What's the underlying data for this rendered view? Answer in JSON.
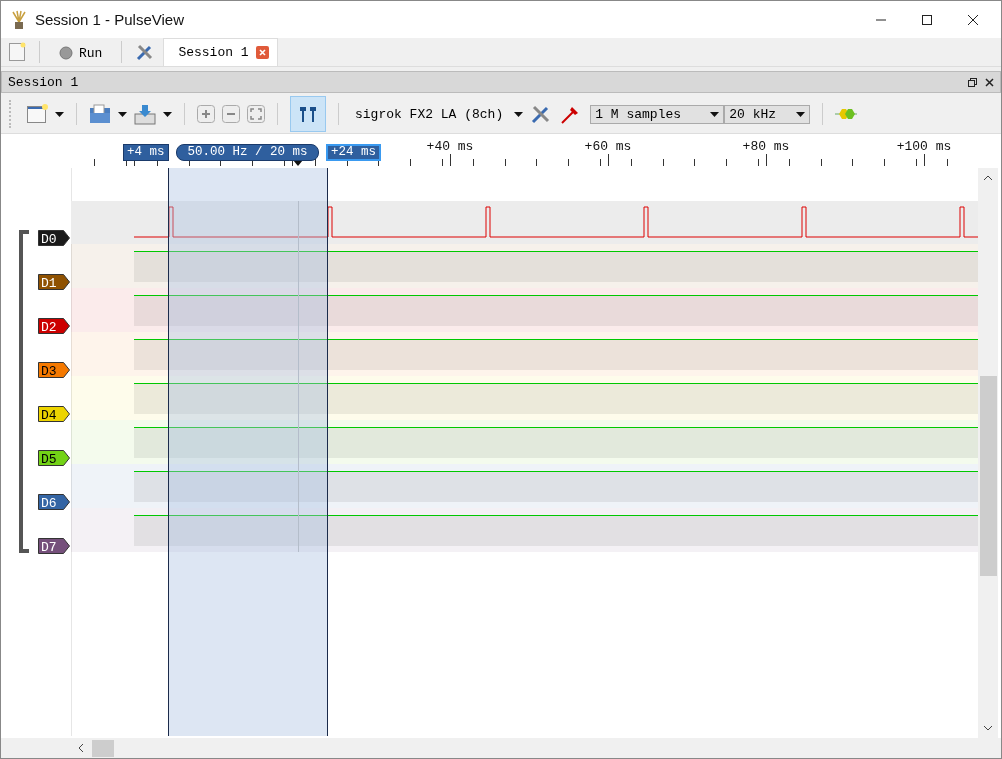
{
  "window": {
    "title": "Session 1 - PulseView"
  },
  "main_toolbar": {
    "run_label": "Run",
    "tabs": [
      {
        "label": "Session 1",
        "selected": true
      }
    ]
  },
  "session": {
    "title": "Session 1"
  },
  "toolbar": {
    "device": "sigrok FX2 LA (8ch)",
    "sample_count": "1 M samples",
    "sample_rate": "20 kHz",
    "cursors_toggle": {
      "on": true
    }
  },
  "ruler": {
    "labels": [
      "+40 ms",
      "+60 ms",
      "+80 ms",
      "+100 ms"
    ]
  },
  "cursors": {
    "left": {
      "label": "+4 ms",
      "selected": false
    },
    "span": "50.00 Hz / 20 ms",
    "right": {
      "label": "+24 ms",
      "selected": true
    }
  },
  "channels": [
    {
      "name": "D0",
      "color": "#1a1a1a",
      "kind": "pulses"
    },
    {
      "name": "D1",
      "color": "#8f5202",
      "kind": "high"
    },
    {
      "name": "D2",
      "color": "#cc0000",
      "kind": "high"
    },
    {
      "name": "D3",
      "color": "#f57900",
      "kind": "high"
    },
    {
      "name": "D4",
      "color": "#edd400",
      "kind": "high"
    },
    {
      "name": "D5",
      "color": "#73d216",
      "kind": "high"
    },
    {
      "name": "D6",
      "color": "#3465a4",
      "kind": "high"
    },
    {
      "name": "D7",
      "color": "#75507b",
      "kind": "high"
    }
  ]
}
